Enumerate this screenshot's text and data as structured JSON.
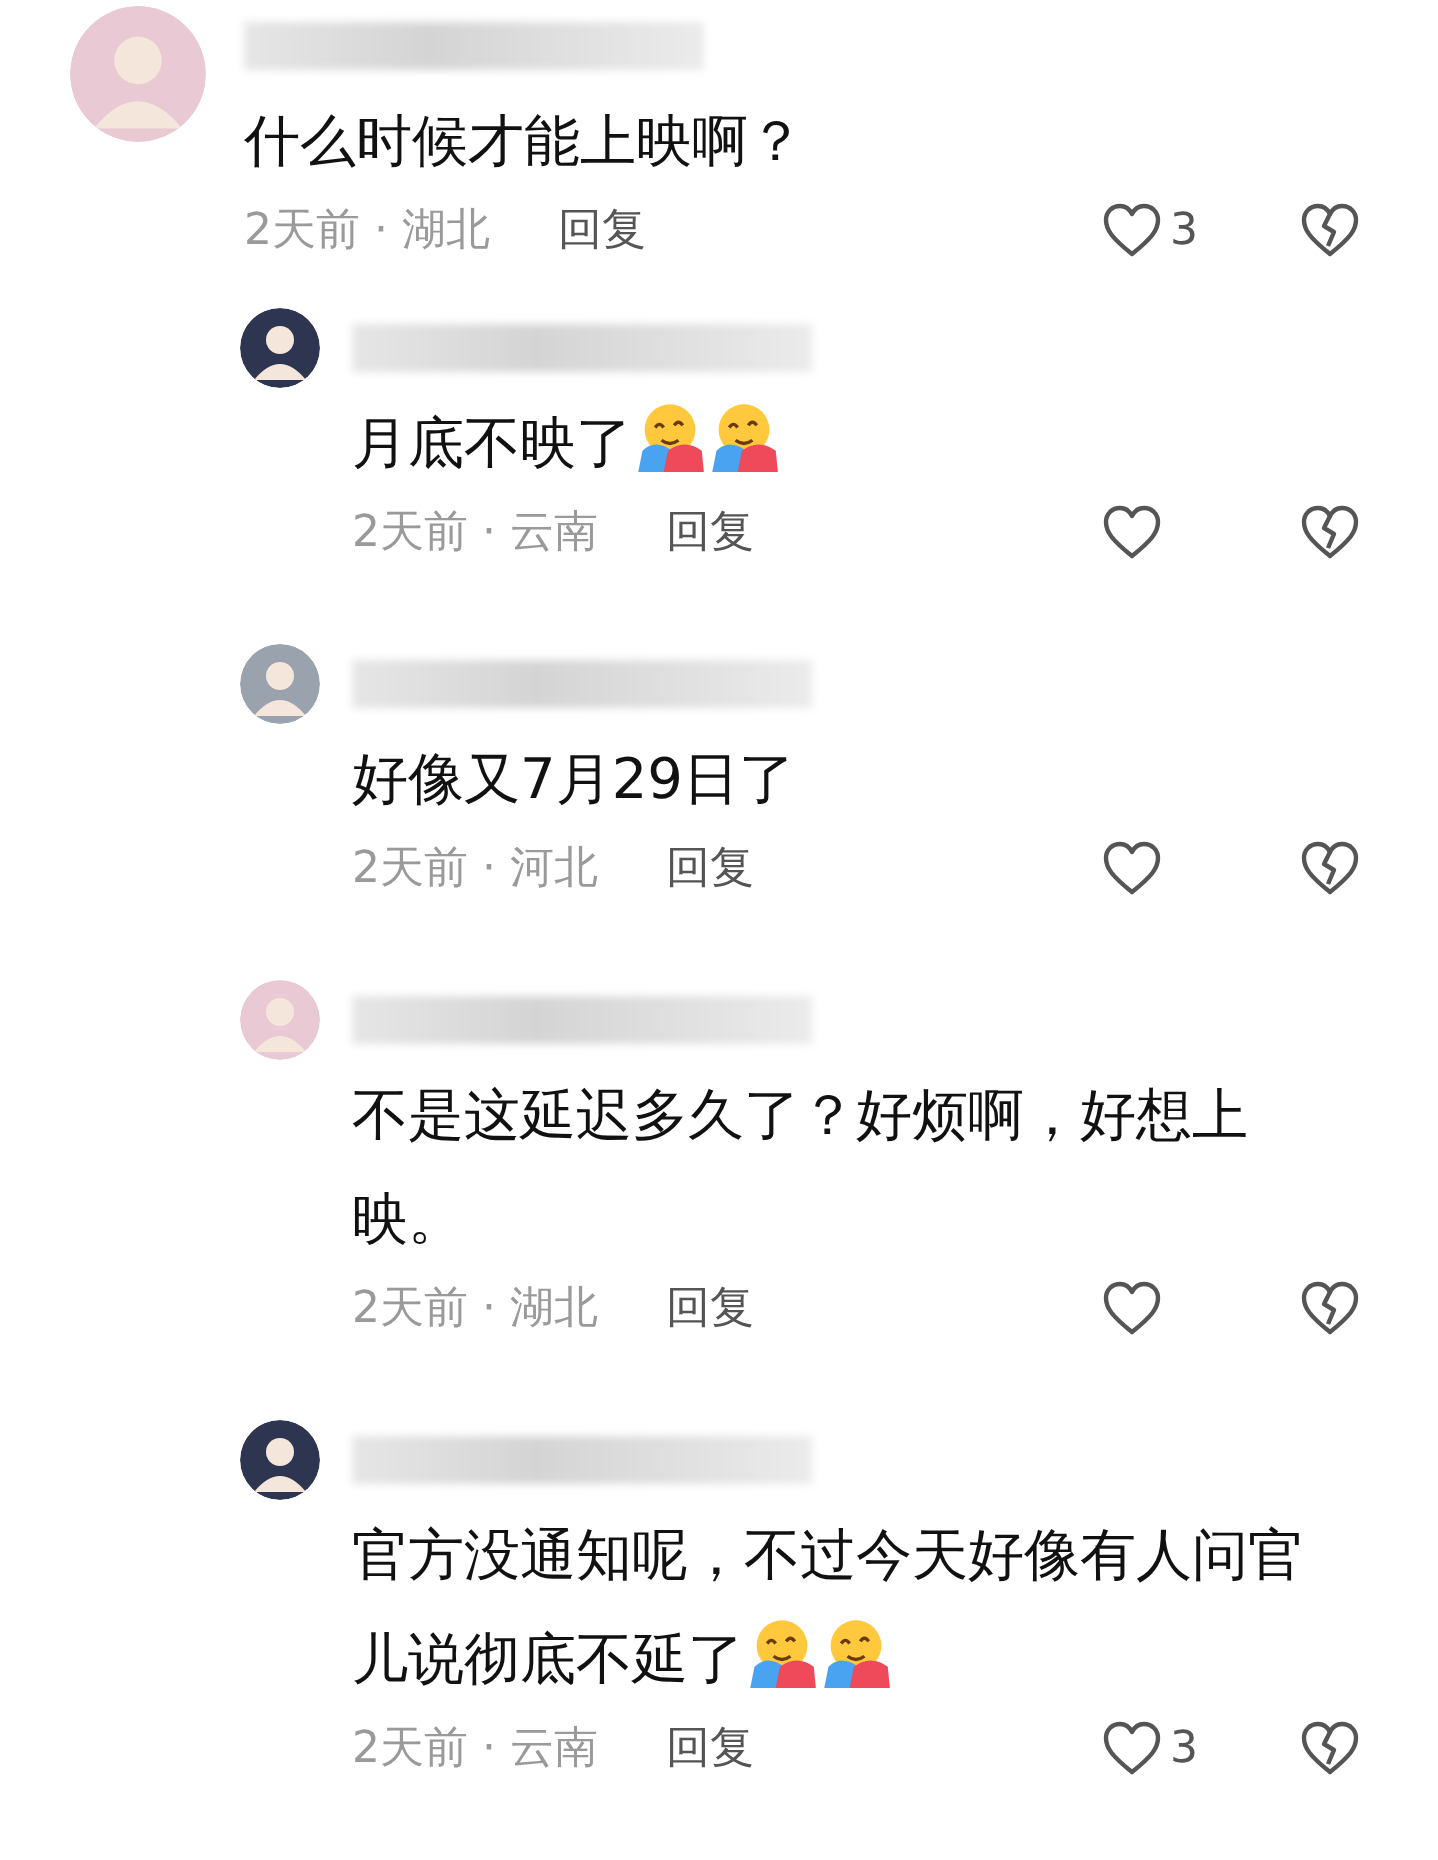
{
  "comments": [
    {
      "avatar": {
        "color": "#e9c9d3"
      },
      "text": "什么时候才能上映啊？",
      "meta": "2天前 · 湖北",
      "reply": "回复",
      "likes": "3",
      "replies": [
        {
          "avatar": {
            "color": "#2e3550"
          },
          "text": "月底不映了",
          "emojis": [
            {
              "kind": "hug"
            },
            {
              "kind": "hug"
            }
          ],
          "meta": "2天前 · 云南",
          "reply": "回复"
        },
        {
          "avatar": {
            "color": "#9aa3ad"
          },
          "text": "好像又7月29日了",
          "meta": "2天前 · 河北",
          "reply": "回复"
        },
        {
          "avatar": {
            "color": "#e9c9d3"
          },
          "text": "不是这延迟多久了？好烦啊，好想上映。",
          "meta": "2天前 · 湖北",
          "reply": "回复"
        },
        {
          "avatar": {
            "color": "#2e3550"
          },
          "text": "官方没通知呢，不过今天好像有人问官儿说彻底不延了",
          "emojis": [
            {
              "kind": "hug"
            },
            {
              "kind": "hug"
            }
          ],
          "meta": "2天前 · 云南",
          "reply": "回复",
          "likes": "3"
        }
      ]
    }
  ]
}
